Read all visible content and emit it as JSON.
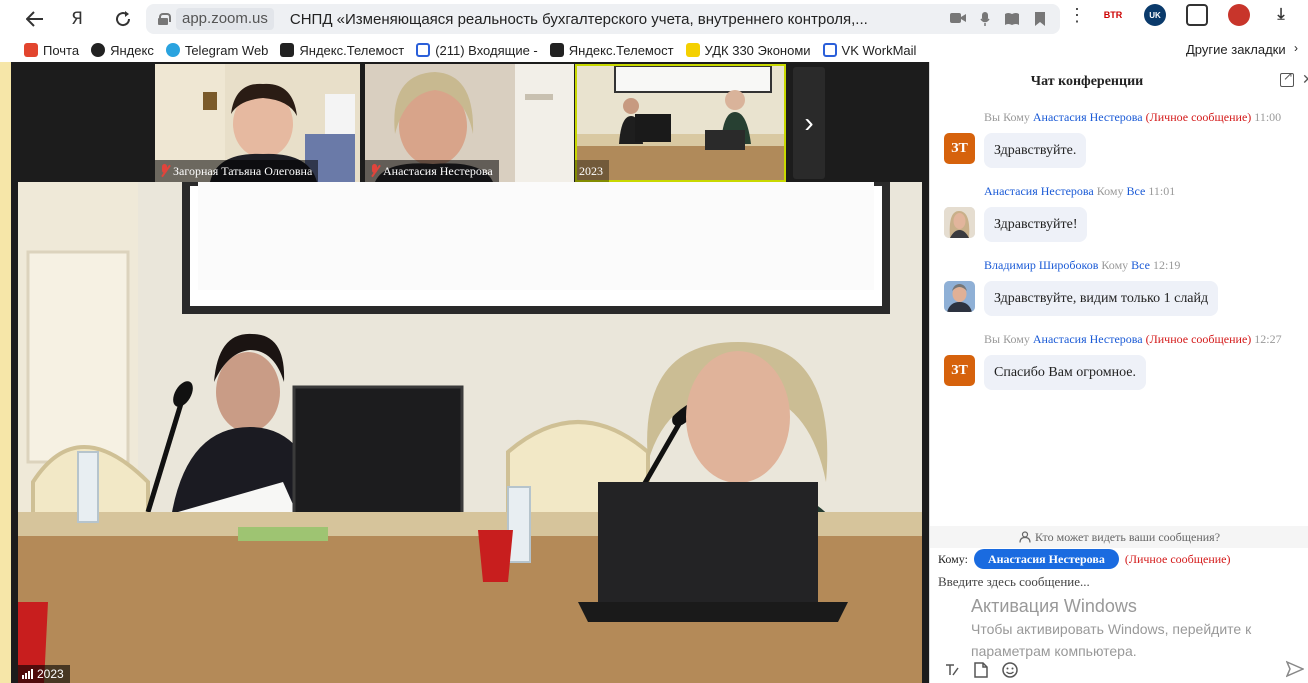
{
  "browser": {
    "back_icon": "arrow-left-icon",
    "yandex_icon": "Я",
    "reload_icon": "reload-icon",
    "url_domain": "app.zoom.us",
    "page_title": "СНПД «Изменяющаяся реальность бухгалтерского учета, внутреннего контроля,...",
    "menu_icon": "⋮",
    "ext_btr": "BTR",
    "ext_uk": "UK"
  },
  "bookmarks": {
    "items": [
      {
        "label": "Почта",
        "color": "#e2452e"
      },
      {
        "label": "Яндекс",
        "color": "#222222"
      },
      {
        "label": "Telegram Web",
        "color": "#2aa3df"
      },
      {
        "label": "Яндекс.Телемост",
        "color": "#222222"
      },
      {
        "label": "(211) Входящие - ",
        "color": "#2b5fd9"
      },
      {
        "label": "Яндекс.Телемост",
        "color": "#222222"
      },
      {
        "label": "УДК 330 Экономи",
        "color": "#f4d000"
      },
      {
        "label": "VK WorkMail",
        "color": "#2b5fd9"
      }
    ],
    "other": "Другие закладки"
  },
  "thumbnails": [
    {
      "label": "Загорная Татьяна Олеговна",
      "muted": true
    },
    {
      "label": "Анастасия Нестерова",
      "muted": true
    },
    {
      "label": "2023",
      "muted": false
    }
  ],
  "main_video": {
    "label": "2023"
  },
  "chat": {
    "title": "Чат конференции",
    "messages": [
      {
        "sender": "Вы",
        "to_word": "Кому",
        "recipient": "Анастасия Нестерова",
        "private": "(Личное сообщение)",
        "time": "11:00",
        "avatar_text": "ЗТ",
        "text": "Здравствуйте."
      },
      {
        "sender": "Анастасия Нестерова",
        "to_word": "Кому",
        "recipient": "Все",
        "private": "",
        "time": "11:01",
        "avatar_text": "",
        "text": "Здравствуйте!"
      },
      {
        "sender": "Владимир Широбоков",
        "to_word": "Кому",
        "recipient": "Все",
        "private": "",
        "time": "12:19",
        "avatar_text": "",
        "text": "Здравствуйте, видим только 1 слайд"
      },
      {
        "sender": "Вы",
        "to_word": "Кому",
        "recipient": "Анастасия Нестерова",
        "private": "(Личное сообщение)",
        "time": "12:27",
        "avatar_text": "ЗТ",
        "text": "Спасибо Вам огромное."
      }
    ],
    "who_can_see": "Кто может видеть ваши сообщения?",
    "to_label": "Кому:",
    "to_recipient": "Анастасия Нестерова",
    "to_private": "(Личное сообщение)",
    "input_placeholder": "Введите здесь сообщение...",
    "activation_title": "Активация Windows",
    "activation_line1": "Чтобы активировать Windows, перейдите к",
    "activation_line2": "параметрам компьютера."
  },
  "colors": {
    "accent_blue": "#1a6be0",
    "private_red": "#d41a1a",
    "avatar_orange": "#d6620c",
    "taskbar_yellow": "#f6e6a8"
  }
}
